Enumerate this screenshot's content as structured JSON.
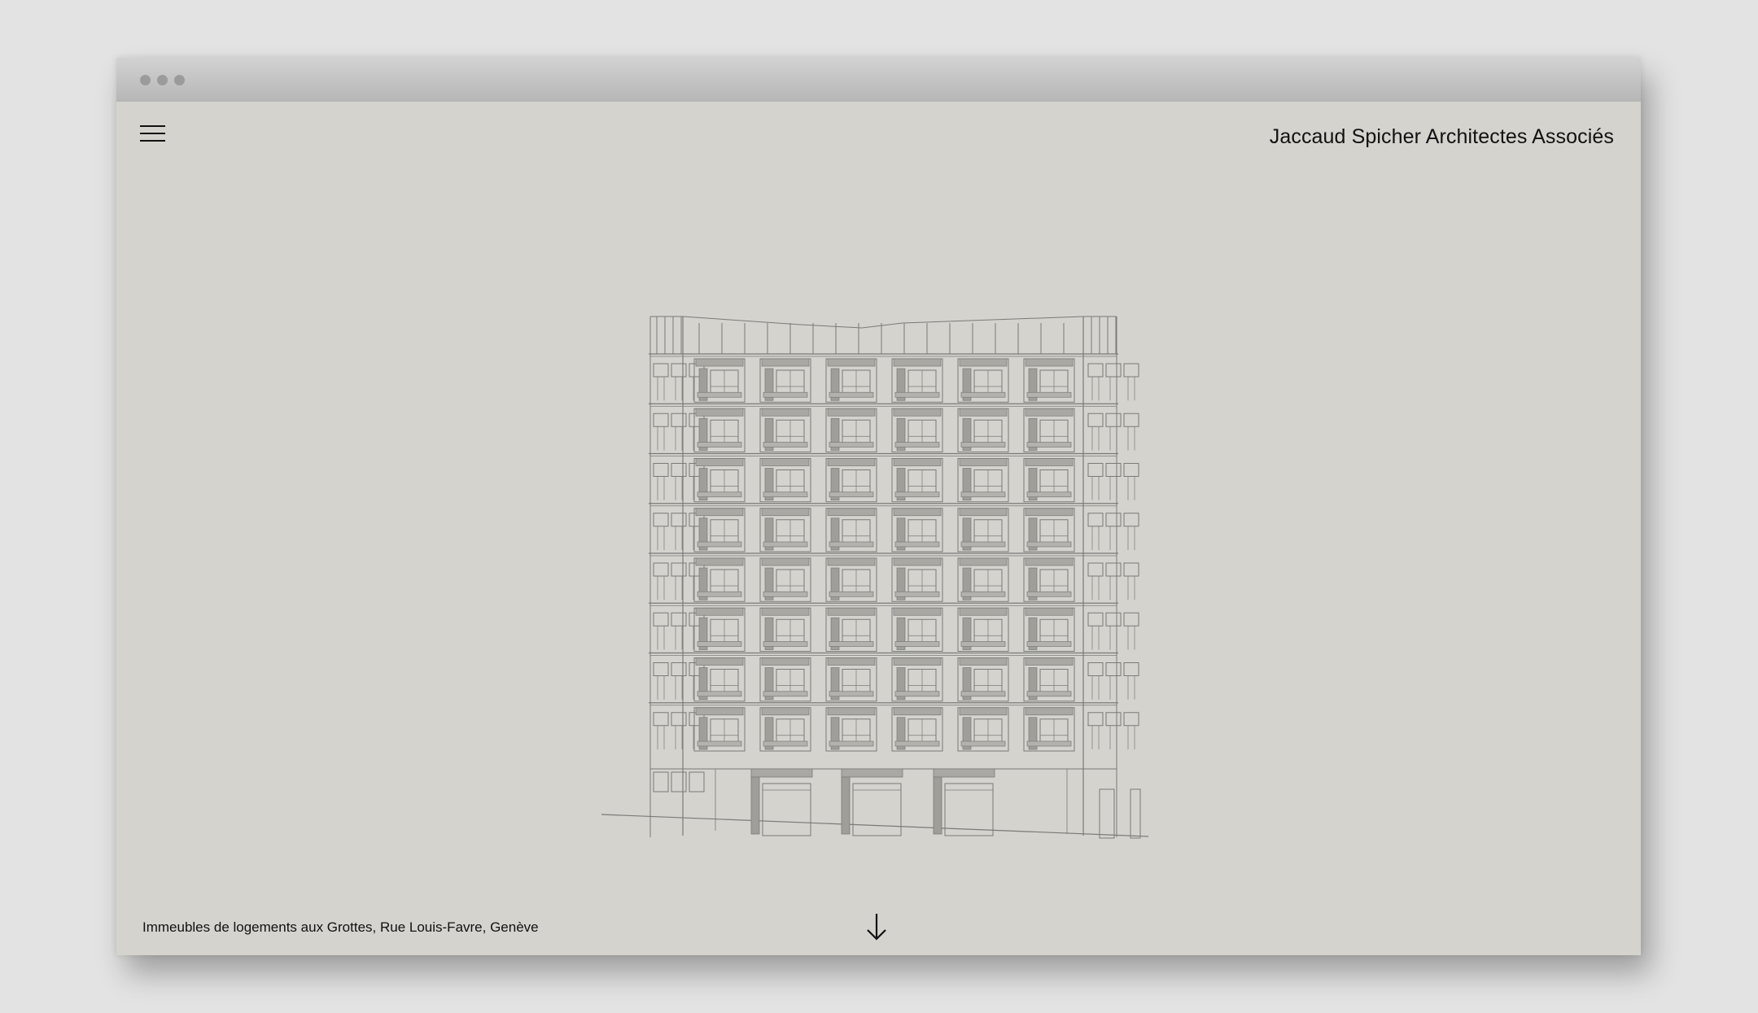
{
  "header": {
    "brand": "Jaccaud Spicher Architectes Associés",
    "menu_icon": "hamburger-menu-icon"
  },
  "window": {
    "controls_icon": "window-dots-icon"
  },
  "hero": {
    "drawing_icon": "building-elevation-drawing"
  },
  "footer": {
    "caption": "Immeubles de logements aux Grottes, Rue Louis-Favre, Genève",
    "scroll_icon": "arrow-down-icon"
  },
  "colors": {
    "page_bg": "#e3e3e3",
    "window_bg": "#d4d3ce",
    "line": "#7a7a77",
    "text": "#111111"
  }
}
